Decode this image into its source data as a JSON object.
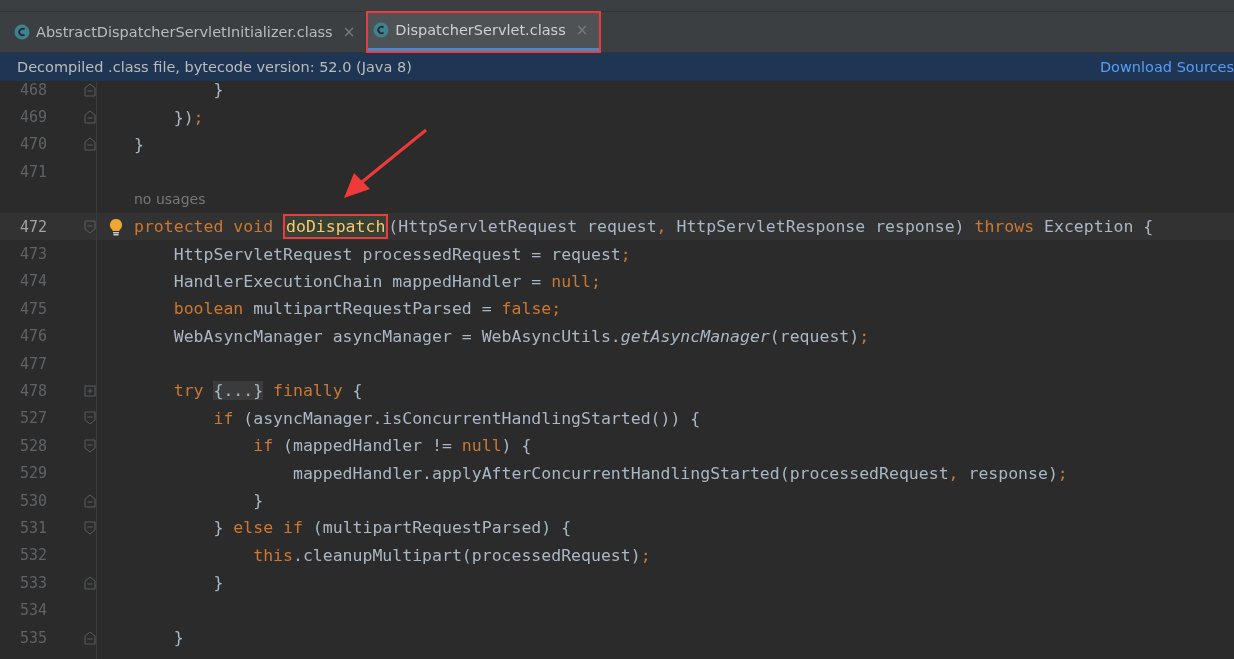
{
  "tabs": [
    {
      "label": "AbstractDispatcherServletInitializer.class",
      "close": "×",
      "selected": false,
      "annotated": false
    },
    {
      "label": "DispatcherServlet.class",
      "close": "×",
      "selected": true,
      "annotated": true
    }
  ],
  "banner": {
    "text": "Decompiled .class file, bytecode version: 52.0 (Java 8)",
    "link": "Download Sources"
  },
  "lines": [
    {
      "kind": "code",
      "number": "468",
      "fold_open": false,
      "fold_close": true,
      "collapsed": false,
      "current": false,
      "bulb": false,
      "tokens": [
        {
          "kind": "text",
          "text": "        }"
        }
      ]
    },
    {
      "kind": "code",
      "number": "469",
      "fold_open": false,
      "fold_close": true,
      "collapsed": false,
      "current": false,
      "bulb": false,
      "tokens": [
        {
          "kind": "text",
          "text": "    })"
        },
        {
          "kind": "punct",
          "text": ";"
        }
      ]
    },
    {
      "kind": "code",
      "number": "470",
      "fold_open": false,
      "fold_close": true,
      "collapsed": false,
      "current": false,
      "bulb": false,
      "tokens": [
        {
          "kind": "text",
          "text": "}"
        }
      ]
    },
    {
      "kind": "code",
      "number": "471",
      "fold_open": false,
      "fold_close": false,
      "collapsed": false,
      "current": false,
      "bulb": false
    },
    {
      "kind": "inlay",
      "text": "no usages"
    },
    {
      "kind": "code",
      "number": "472",
      "fold_open": true,
      "fold_close": false,
      "collapsed": false,
      "current": true,
      "bulb": true,
      "tokens": [
        {
          "kind": "kw",
          "text": "protected void "
        },
        {
          "kind": "method",
          "text": "doDispatch",
          "annotated": true
        },
        {
          "kind": "text",
          "text": "(HttpServletRequest request"
        },
        {
          "kind": "punct",
          "text": ", "
        },
        {
          "kind": "text",
          "text": "HttpServletResponse response) "
        },
        {
          "kind": "kw",
          "text": "throws "
        },
        {
          "kind": "text",
          "text": "Exception {"
        }
      ]
    },
    {
      "kind": "code",
      "number": "473",
      "fold_open": false,
      "fold_close": false,
      "collapsed": false,
      "current": false,
      "bulb": false,
      "tokens": [
        {
          "kind": "text",
          "text": "    HttpServletRequest processedRequest = request"
        },
        {
          "kind": "punct",
          "text": ";"
        }
      ]
    },
    {
      "kind": "code",
      "number": "474",
      "fold_open": false,
      "fold_close": false,
      "collapsed": false,
      "current": false,
      "bulb": false,
      "tokens": [
        {
          "kind": "text",
          "text": "    HandlerExecutionChain mappedHandler = "
        },
        {
          "kind": "kw",
          "text": "null;"
        }
      ]
    },
    {
      "kind": "code",
      "number": "475",
      "fold_open": false,
      "fold_close": false,
      "collapsed": false,
      "current": false,
      "bulb": false,
      "tokens": [
        {
          "kind": "kw",
          "text": "    boolean "
        },
        {
          "kind": "text",
          "text": "multipartRequestParsed = "
        },
        {
          "kind": "kw",
          "text": "false;"
        }
      ]
    },
    {
      "kind": "code",
      "number": "476",
      "fold_open": false,
      "fold_close": false,
      "collapsed": false,
      "current": false,
      "bulb": false,
      "tokens": [
        {
          "kind": "text",
          "text": "    WebAsyncManager asyncManager = WebAsyncUtils."
        },
        {
          "kind": "italic",
          "text": "getAsyncManager"
        },
        {
          "kind": "text",
          "text": "(request)"
        },
        {
          "kind": "punct",
          "text": ";"
        }
      ]
    },
    {
      "kind": "code",
      "number": "477",
      "fold_open": false,
      "fold_close": false,
      "collapsed": false,
      "current": false,
      "bulb": false
    },
    {
      "kind": "code",
      "number": "478",
      "fold_open": false,
      "fold_close": false,
      "collapsed": true,
      "current": false,
      "bulb": false,
      "tokens": [
        {
          "kind": "kw",
          "text": "    try "
        },
        {
          "kind": "folded",
          "text": "{...}"
        },
        {
          "kind": "kw",
          "text": " finally "
        },
        {
          "kind": "text",
          "text": "{"
        }
      ]
    },
    {
      "kind": "code",
      "number": "527",
      "fold_open": true,
      "fold_close": false,
      "collapsed": false,
      "current": false,
      "bulb": false,
      "tokens": [
        {
          "kind": "kw",
          "text": "        if "
        },
        {
          "kind": "text",
          "text": "(asyncManager.isConcurrentHandlingStarted()) {"
        }
      ]
    },
    {
      "kind": "code",
      "number": "528",
      "fold_open": true,
      "fold_close": false,
      "collapsed": false,
      "current": false,
      "bulb": false,
      "tokens": [
        {
          "kind": "kw",
          "text": "            if "
        },
        {
          "kind": "text",
          "text": "(mappedHandler != "
        },
        {
          "kind": "kw",
          "text": "null"
        },
        {
          "kind": "text",
          "text": ") {"
        }
      ]
    },
    {
      "kind": "code",
      "number": "529",
      "fold_open": false,
      "fold_close": false,
      "collapsed": false,
      "current": false,
      "bulb": false,
      "tokens": [
        {
          "kind": "text",
          "text": "                mappedHandler.applyAfterConcurrentHandlingStarted(processedRequest"
        },
        {
          "kind": "punct",
          "text": ", "
        },
        {
          "kind": "text",
          "text": "response)"
        },
        {
          "kind": "punct",
          "text": ";"
        }
      ]
    },
    {
      "kind": "code",
      "number": "530",
      "fold_open": false,
      "fold_close": true,
      "collapsed": false,
      "current": false,
      "bulb": false,
      "tokens": [
        {
          "kind": "text",
          "text": "            }"
        }
      ]
    },
    {
      "kind": "code",
      "number": "531",
      "fold_open": true,
      "fold_close": false,
      "collapsed": false,
      "current": false,
      "bulb": false,
      "tokens": [
        {
          "kind": "text",
          "text": "        } "
        },
        {
          "kind": "kw",
          "text": "else if "
        },
        {
          "kind": "text",
          "text": "(multipartRequestParsed) {"
        }
      ]
    },
    {
      "kind": "code",
      "number": "532",
      "fold_open": false,
      "fold_close": false,
      "collapsed": false,
      "current": false,
      "bulb": false,
      "tokens": [
        {
          "kind": "kw",
          "text": "            this"
        },
        {
          "kind": "text",
          "text": ".cleanupMultipart(processedRequest)"
        },
        {
          "kind": "punct",
          "text": ";"
        }
      ]
    },
    {
      "kind": "code",
      "number": "533",
      "fold_open": false,
      "fold_close": true,
      "collapsed": false,
      "current": false,
      "bulb": false,
      "tokens": [
        {
          "kind": "text",
          "text": "        }"
        }
      ]
    },
    {
      "kind": "code",
      "number": "534",
      "fold_open": false,
      "fold_close": false,
      "collapsed": false,
      "current": false,
      "bulb": false
    },
    {
      "kind": "code",
      "number": "535",
      "fold_open": false,
      "fold_close": true,
      "collapsed": false,
      "current": false,
      "bulb": false,
      "tokens": [
        {
          "kind": "text",
          "text": "    }"
        }
      ]
    }
  ]
}
